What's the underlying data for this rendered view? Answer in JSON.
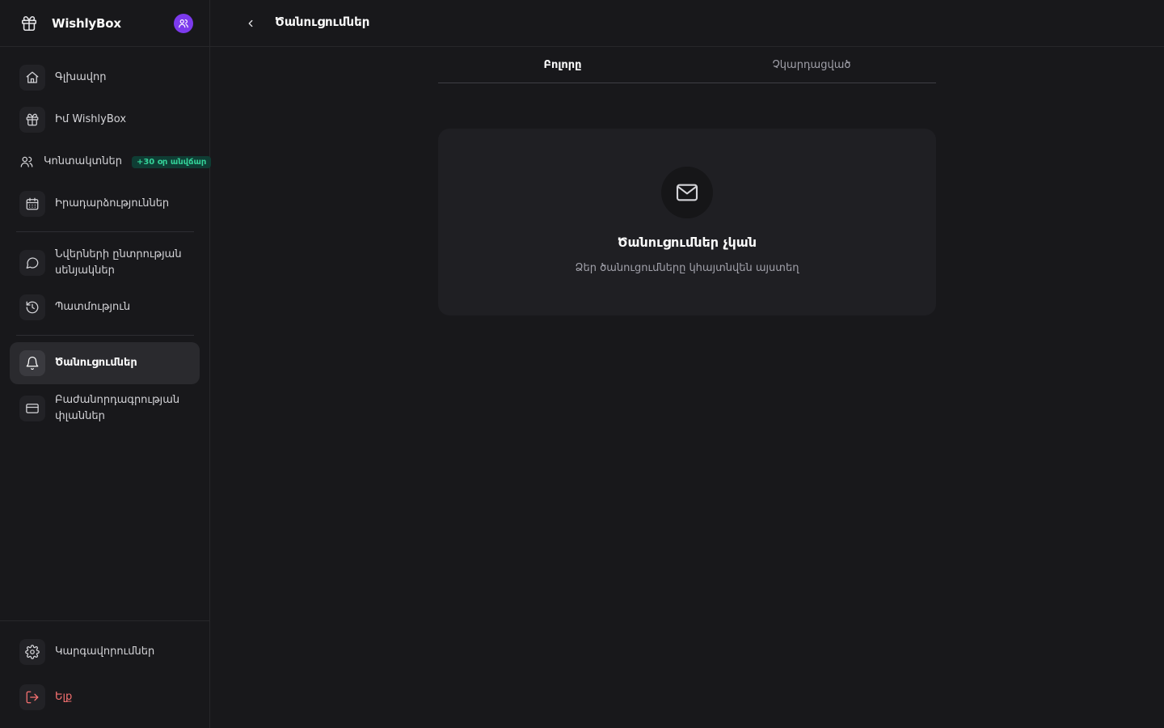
{
  "app": {
    "name": "WishlyBox"
  },
  "sidebar": {
    "items": [
      {
        "label": "Գլխավոր",
        "icon": "home-icon"
      },
      {
        "label": "Իմ WishlyBox",
        "icon": "gift-icon"
      },
      {
        "label": "Կոնտակտներ",
        "icon": "users-icon",
        "badge": "+30 օր անվճար"
      },
      {
        "label": "Իրադարձություններ",
        "icon": "calendar-icon"
      },
      {
        "label": "Նվերների ընտրության սենյակներ",
        "icon": "chat-icon"
      },
      {
        "label": "Պատմություն",
        "icon": "history-icon"
      },
      {
        "label": "Ծանուցումներ",
        "icon": "bell-icon",
        "active": true
      },
      {
        "label": "Բաժանորդագրության փլաններ",
        "icon": "credit-card-icon"
      }
    ],
    "footer": {
      "settings": "Կարգավորումներ",
      "logout": "Ելք"
    }
  },
  "header": {
    "title": "Ծանուցումներ"
  },
  "tabs": [
    {
      "label": "Բոլորը",
      "active": true
    },
    {
      "label": "Չկարդացված",
      "active": false
    }
  ],
  "empty_state": {
    "icon": "mail-icon",
    "title": "Ծանուցումներ չկան",
    "subtitle": "Ձեր ծանուցումները կհայտնվեն այստեղ"
  },
  "colors": {
    "background": "#18181b",
    "card": "#1f1f23",
    "accent": "#7c3aed",
    "badge_bg": "#0f3d34",
    "badge_text": "#34d399",
    "danger": "#f87171"
  }
}
